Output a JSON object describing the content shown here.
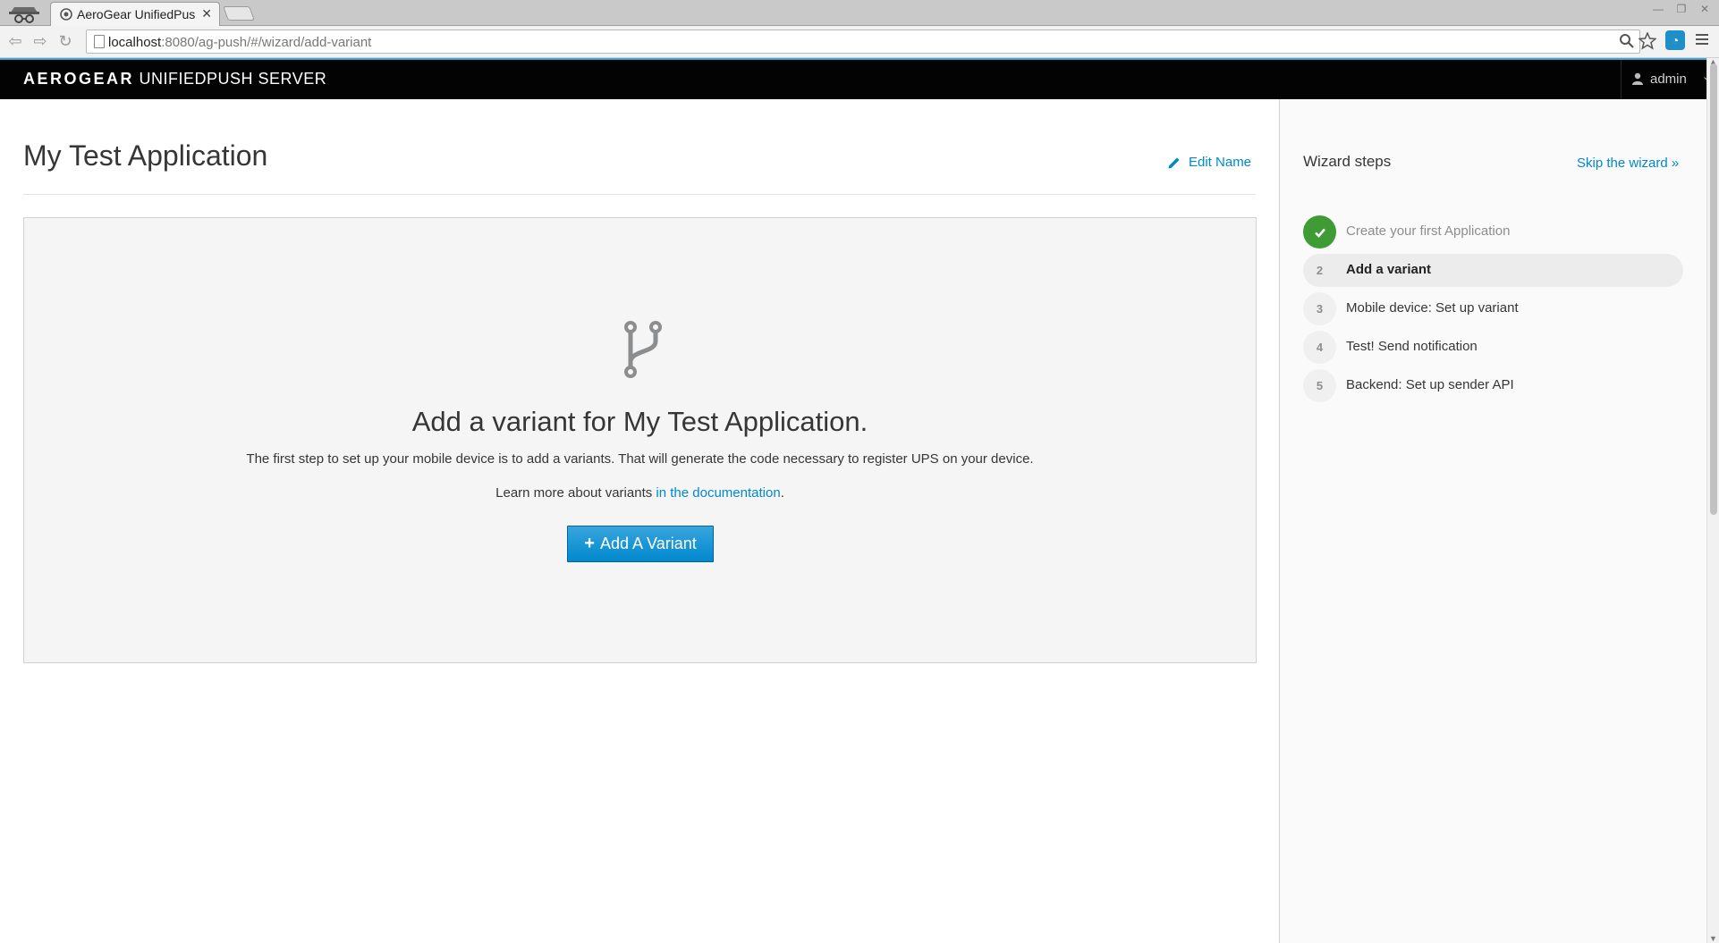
{
  "browser": {
    "tab_title": "AeroGear UnifiedPus",
    "url_host": "localhost",
    "url_rest": ":8080/ag-push/#/wizard/add-variant"
  },
  "header": {
    "brand_bold": "AEROGEAR",
    "brand_light": "UNIFIEDPUSH SERVER",
    "user": "admin"
  },
  "main": {
    "title": "My Test Application",
    "edit_label": "Edit Name",
    "blank": {
      "heading": "Add a variant for My Test Application.",
      "description": "The first step to set up your mobile device is to add a variants. That will generate the code necessary to register UPS on your device.",
      "learn_prefix": "Learn more about variants ",
      "learn_link": "in the documentation",
      "learn_suffix": ".",
      "button_label": "Add A Variant"
    }
  },
  "sidebar": {
    "title": "Wizard steps",
    "skip_label": "Skip the wizard »",
    "steps": [
      {
        "num": "",
        "label": "Create your first Application",
        "state": "done"
      },
      {
        "num": "2",
        "label": "Add a variant",
        "state": "active"
      },
      {
        "num": "3",
        "label": "Mobile device: Set up variant",
        "state": "pending"
      },
      {
        "num": "4",
        "label": "Test! Send notification",
        "state": "pending"
      },
      {
        "num": "5",
        "label": "Backend: Set up sender API",
        "state": "pending"
      }
    ]
  },
  "colors": {
    "accent": "#0088ce",
    "done": "#3f9c35",
    "header_bg": "#030303"
  }
}
